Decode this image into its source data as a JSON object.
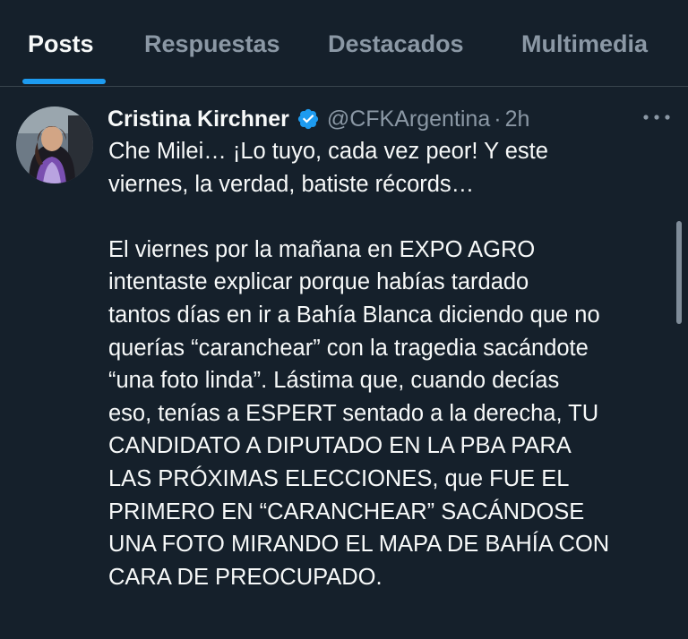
{
  "tabs": [
    {
      "label": "Posts",
      "active": true
    },
    {
      "label": "Respuestas",
      "active": false
    },
    {
      "label": "Destacados",
      "active": false
    },
    {
      "label": "Multimedia",
      "active": false
    }
  ],
  "tweet": {
    "author_name": "Cristina Kirchner",
    "verified": true,
    "verified_icon": "verified-badge-icon",
    "handle": "@CFKArgentina",
    "separator": "·",
    "time": "2h",
    "more_icon": "more-options-icon",
    "text_lines": [
      "Che Milei… ¡Lo tuyo, cada vez peor! Y este",
      "viernes, la verdad, batiste récords…",
      "",
      "El viernes por la mañana en EXPO AGRO",
      "intentaste explicar porque habías tardado",
      "tantos días en ir a Bahía Blanca diciendo que no",
      "querías “caranchear” con la tragedia sacándote",
      "“una foto linda”. Lástima que, cuando decías",
      "eso, tenías a ESPERT sentado a la derecha, TU",
      "CANDIDATO A DIPUTADO EN LA PBA PARA",
      "LAS PRÓXIMAS ELECCIONES, que FUE EL",
      "PRIMERO EN “CARANCHEAR” SACÁNDOSE",
      "UNA FOTO MIRANDO EL MAPA DE BAHÍA CON",
      "CARA DE PREOCUPADO."
    ]
  },
  "colors": {
    "background": "#15202b",
    "text_primary": "#f7f9f9",
    "text_secondary": "#8b98a5",
    "accent": "#1d9bf0",
    "divider": "#38444d"
  }
}
